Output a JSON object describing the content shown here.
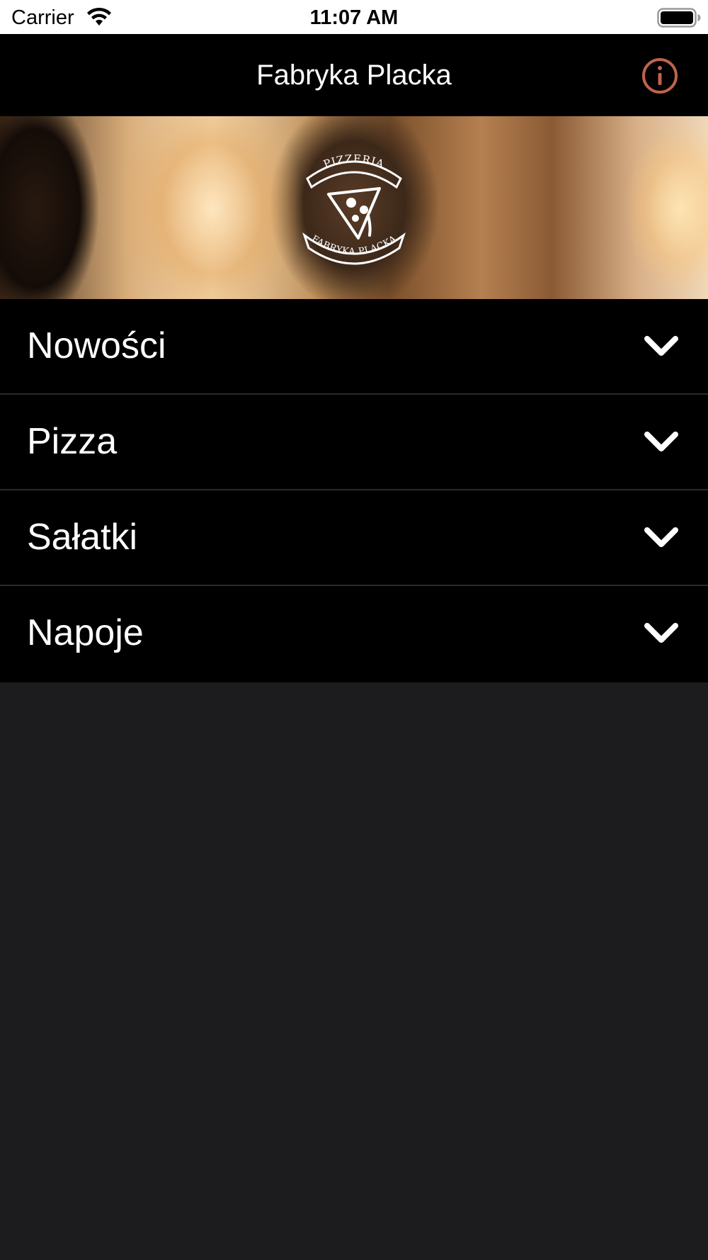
{
  "status_bar": {
    "carrier": "Carrier",
    "time": "11:07 AM",
    "wifi_icon": "wifi-icon",
    "battery_icon": "battery-icon"
  },
  "nav_bar": {
    "title": "Fabryka Placka",
    "info_icon": "info-icon",
    "accent_color": "#c0634d"
  },
  "banner": {
    "logo_text_top": "PIZZERIA",
    "logo_text_bottom": "FABRYKA PLACKA"
  },
  "menu": {
    "items": [
      {
        "label": "Nowości",
        "icon": "chevron-down-icon"
      },
      {
        "label": "Pizza",
        "icon": "chevron-down-icon"
      },
      {
        "label": "Sałatki",
        "icon": "chevron-down-icon"
      },
      {
        "label": "Napoje",
        "icon": "chevron-down-icon"
      }
    ]
  },
  "colors": {
    "background": "#1c1c1e",
    "nav_background": "#000000",
    "row_separator": "#2a2a2c",
    "text": "#ffffff"
  }
}
